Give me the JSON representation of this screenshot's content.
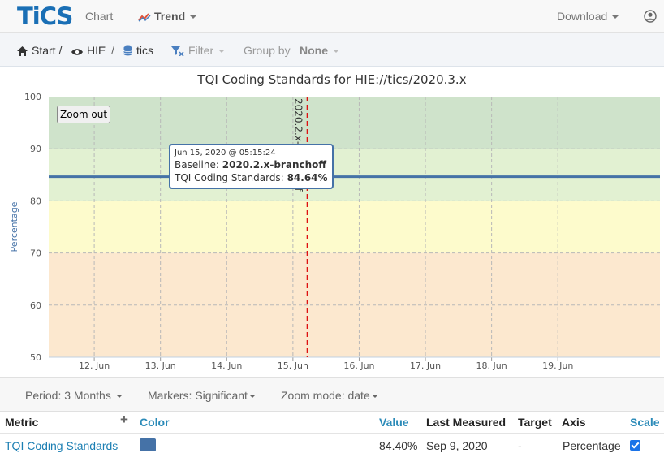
{
  "navbar": {
    "logo": "TiCS",
    "items": [
      {
        "label": "Chart"
      },
      {
        "label": "Trend"
      }
    ],
    "download_label": "Download"
  },
  "breadcrumb": {
    "start": "Start /",
    "project": "HIE",
    "sep": "/",
    "branch": "tics",
    "filter": "Filter",
    "group_by_label": "Group by",
    "group_by_value": "None"
  },
  "chart": {
    "title": "TQI Coding Standards for HIE://tics/2020.3.x",
    "zoom_out_label": "Zoom out",
    "tooltip": {
      "date": "Jun 15, 2020 @ 05:15:24",
      "baseline_label": "Baseline:",
      "baseline_value": "2020.2.x-branchoff",
      "metric_label": "TQI Coding Standards:",
      "metric_value": "84.64%"
    }
  },
  "chart_data": {
    "type": "line",
    "title": "TQI Coding Standards for HIE://tics/2020.3.x",
    "xlabel": "",
    "ylabel": "Percentage",
    "ylim": [
      50,
      100
    ],
    "yticks": [
      50,
      60,
      70,
      80,
      90,
      100
    ],
    "xticks": [
      "12. Jun",
      "13. Jun",
      "14. Jun",
      "15. Jun",
      "16. Jun",
      "17. Jun",
      "18. Jun",
      "19. Jun"
    ],
    "xlim": [
      "2020-06-11 07:30",
      "2020-06-20 13:00"
    ],
    "grid": true,
    "bands": [
      {
        "from": 90,
        "to": 100,
        "color": "#cfe3cb"
      },
      {
        "from": 80,
        "to": 90,
        "color": "#e2f1d2"
      },
      {
        "from": 70,
        "to": 80,
        "color": "#fdfbcc"
      },
      {
        "from": 50,
        "to": 70,
        "color": "#fce8cf"
      }
    ],
    "series": [
      {
        "name": "TQI Coding Standards",
        "color": "#4572a7",
        "x": [
          "2020-06-11 07:30",
          "2020-06-15 05:15",
          "2020-06-20 13:00"
        ],
        "y": [
          84.64,
          84.64,
          84.64
        ]
      }
    ],
    "marker": {
      "label": "2020.2.x-branchoff",
      "x": "2020-06-15 05:15",
      "color": "#dd1111"
    },
    "highlight_point": {
      "x": "2020-06-15 05:15",
      "y": 84.64
    }
  },
  "controls": {
    "period": "Period: 3 Months",
    "markers": "Markers: Significant",
    "zoom_mode": "Zoom mode: date"
  },
  "table": {
    "headers": {
      "metric": "Metric",
      "add": "+",
      "color": "Color",
      "value": "Value",
      "last_measured": "Last Measured",
      "target": "Target",
      "axis": "Axis",
      "scale": "Scale"
    },
    "rows": [
      {
        "metric": "TQI Coding Standards",
        "color": "#4572a7",
        "value": "84.40%",
        "last_measured": "Sep 9, 2020",
        "target": "-",
        "axis": "Percentage",
        "scale_checked": true
      }
    ]
  }
}
